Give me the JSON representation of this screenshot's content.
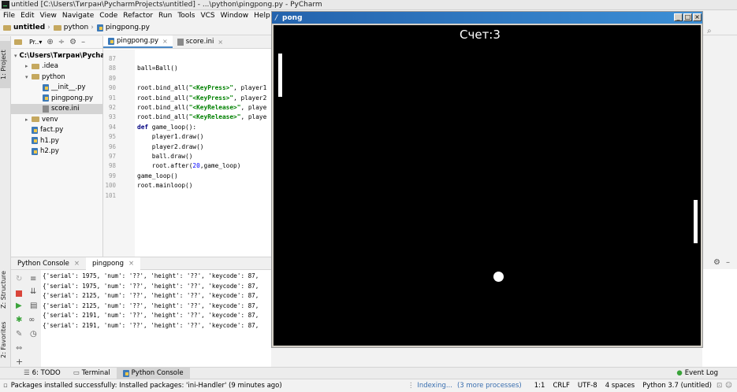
{
  "window": {
    "title": "untitled [C:\\Users\\Тигран\\PycharmProjects\\untitled] - ...\\python\\pingpong.py - PyCharm"
  },
  "menu": [
    "File",
    "Edit",
    "View",
    "Navigate",
    "Code",
    "Refactor",
    "Run",
    "Tools",
    "VCS",
    "Window",
    "Help"
  ],
  "breadcrumbs": [
    "untitled",
    "python",
    "pingpong.py"
  ],
  "left_strip": {
    "project": "1: Project",
    "structure": "Z: Structure",
    "favorites": "2: Favorites"
  },
  "project_panel": {
    "label": "Pr..▾",
    "items": [
      {
        "label": "C:\\Users\\Тигран\\Pycharm",
        "indent": 0,
        "kind": "folder",
        "arrow": "▾"
      },
      {
        "label": ".idea",
        "indent": 1,
        "kind": "folder",
        "arrow": "▸"
      },
      {
        "label": "python",
        "indent": 1,
        "kind": "folder",
        "arrow": "▾"
      },
      {
        "label": "__init__.py",
        "indent": 2,
        "kind": "py",
        "arrow": ""
      },
      {
        "label": "pingpong.py",
        "indent": 2,
        "kind": "py",
        "arrow": ""
      },
      {
        "label": "score.ini",
        "indent": 2,
        "kind": "ini",
        "arrow": "",
        "selected": true
      },
      {
        "label": "venv",
        "indent": 1,
        "kind": "folder",
        "arrow": "▸"
      },
      {
        "label": "fact.py",
        "indent": 1,
        "kind": "py",
        "arrow": ""
      },
      {
        "label": "h1.py",
        "indent": 1,
        "kind": "py",
        "arrow": ""
      },
      {
        "label": "h2.py",
        "indent": 1,
        "kind": "py",
        "arrow": ""
      }
    ]
  },
  "editor": {
    "tabs": [
      {
        "label": "pingpong.py",
        "active": true
      },
      {
        "label": "score.ini",
        "active": false
      }
    ],
    "lines": [
      {
        "n": "87",
        "code": ""
      },
      {
        "n": "88",
        "code": "ball=Ball()"
      },
      {
        "n": "89",
        "code": ""
      },
      {
        "n": "90",
        "code": "root.bind_all(\"<KeyPress>\", player1"
      },
      {
        "n": "91",
        "code": "root.bind_all(\"<KeyPress>\", player2"
      },
      {
        "n": "92",
        "code": "root.bind_all(\"<KeyRelease>\", playe"
      },
      {
        "n": "93",
        "code": "root.bind_all(\"<KeyRelease>\", playe"
      },
      {
        "n": "94",
        "code": "def game_loop():"
      },
      {
        "n": "95",
        "code": "    player1.draw()"
      },
      {
        "n": "96",
        "code": "    player2.draw()"
      },
      {
        "n": "97",
        "code": "    ball.draw()"
      },
      {
        "n": "98",
        "code": "    root.after(20,game_loop)"
      },
      {
        "n": "99",
        "code": "game_loop()"
      },
      {
        "n": "100",
        "code": "root.mainloop()"
      },
      {
        "n": "101",
        "code": ""
      }
    ]
  },
  "console": {
    "tabs": [
      {
        "label": "Python Console",
        "active": false
      },
      {
        "label": "pingpong",
        "active": true
      }
    ],
    "lines": [
      "{'serial': 1975, 'num': '??', 'height': '??', 'keycode': 87,",
      "{'serial': 1975, 'num': '??', 'height': '??', 'keycode': 87,",
      "{'serial': 2125, 'num': '??', 'height': '??', 'keycode': 87,",
      "{'serial': 2125, 'num': '??', 'height': '??', 'keycode': 87,",
      "{'serial': 2191, 'num': '??', 'height': '??', 'keycode': 87,",
      "{'serial': 2191, 'num': '??', 'height': '??', 'keycode': 87,"
    ]
  },
  "bottom_bar": {
    "todo": "6: TODO",
    "terminal": "Terminal",
    "python_console": "Python Console",
    "event_log": "Event Log"
  },
  "status_bar": {
    "message": "Packages installed successfully: Installed packages: 'ini-Handler' (9 minutes ago)",
    "indexing": "Indexing...",
    "more": "(3 more processes)",
    "position": "1:1",
    "line_sep": "CRLF",
    "encoding": "UTF-8",
    "indent": "4 spaces",
    "interpreter": "Python 3.7 (untitled)"
  },
  "pong": {
    "title": "pong",
    "score": "Счет:3",
    "colors": {
      "background": "#000000",
      "paddle": "#ffffff",
      "ball": "#ffffff"
    }
  }
}
